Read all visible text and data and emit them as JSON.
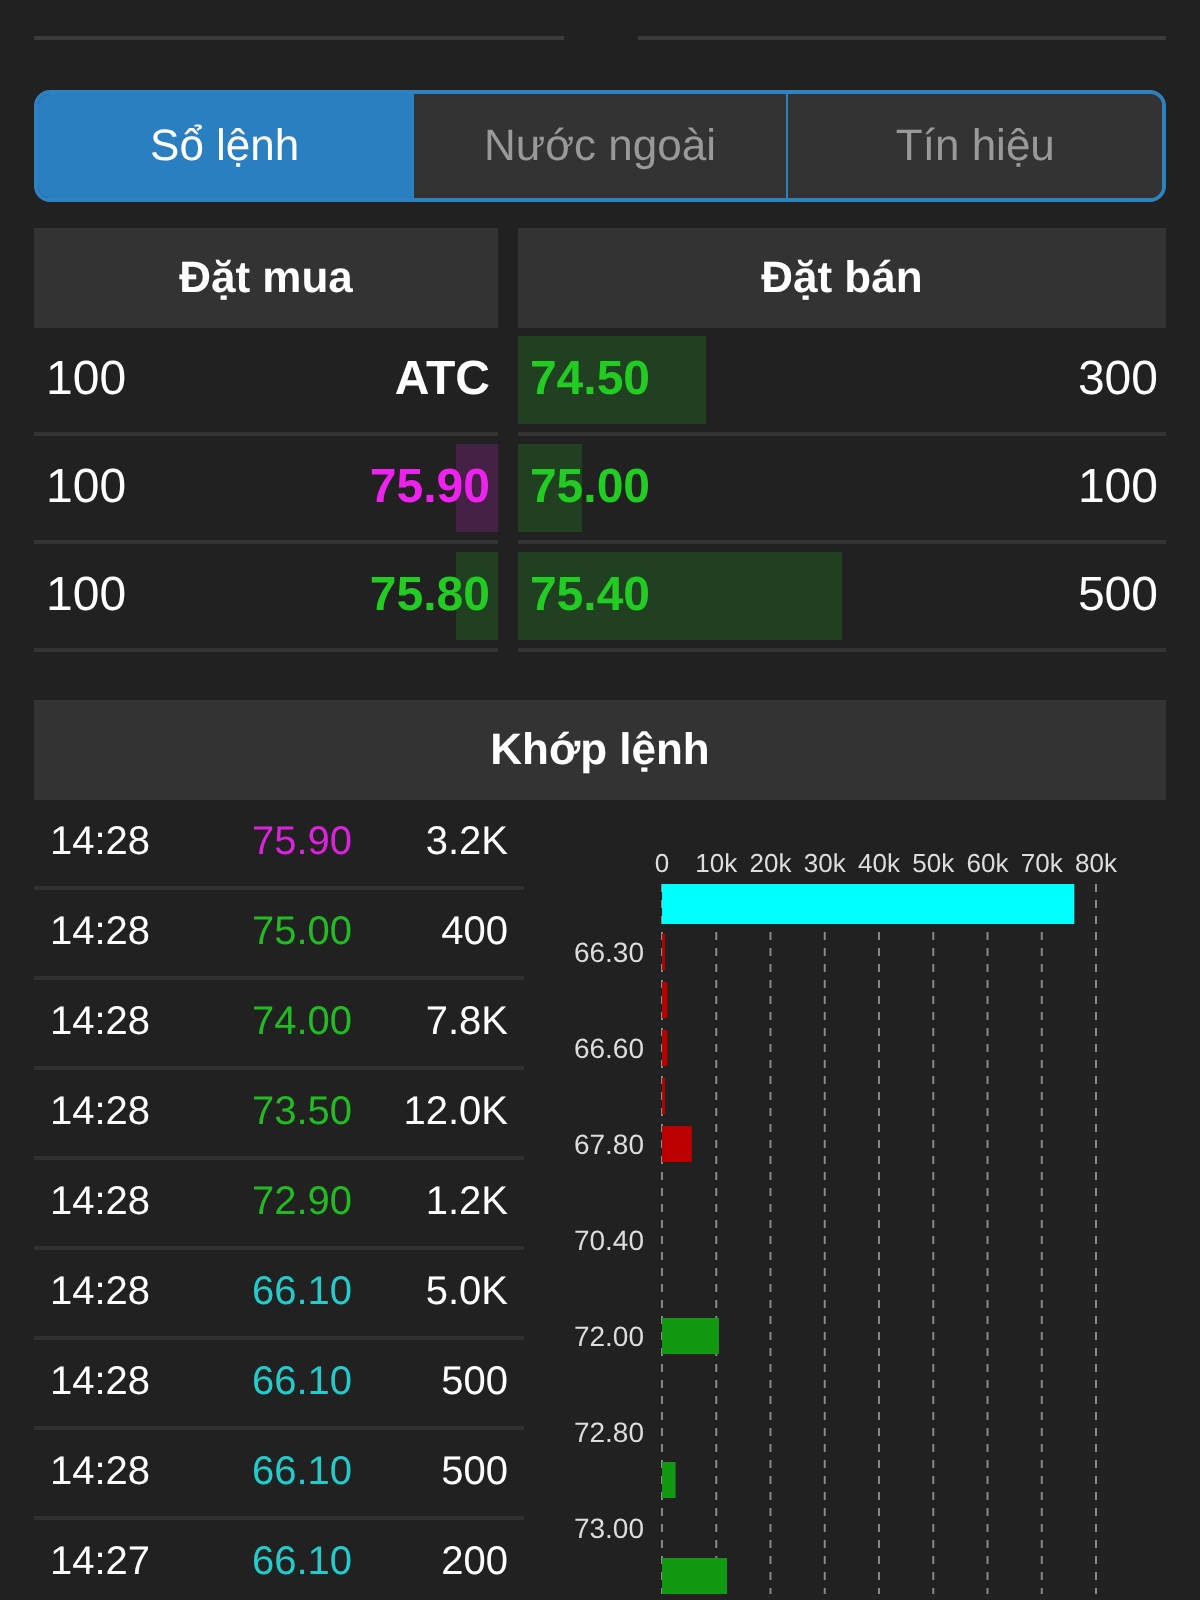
{
  "tabs": [
    {
      "label": "Sổ lệnh",
      "selected": true
    },
    {
      "label": "Nước ngoài",
      "selected": false
    },
    {
      "label": "Tín hiệu",
      "selected": false
    }
  ],
  "order_book": {
    "bid_title": "Đặt mua",
    "ask_title": "Đặt bán",
    "rows": [
      {
        "bid": {
          "volume": "100",
          "price": "ATC",
          "color": "#ffffff"
        },
        "ask": {
          "price": "74.50",
          "color": "#22cc22",
          "level": 0.29,
          "volume": "300"
        }
      },
      {
        "bid": {
          "volume": "100",
          "price": "75.90",
          "color": "#ee22ee",
          "level": 0.09
        },
        "ask": {
          "price": "75.00",
          "color": "#22cc22",
          "level": 0.1,
          "volume": "100"
        }
      },
      {
        "bid": {
          "volume": "100",
          "price": "75.80",
          "color": "#22cc22",
          "level": 0.09
        },
        "ask": {
          "price": "75.40",
          "color": "#22cc22",
          "level": 0.5,
          "volume": "500"
        }
      }
    ]
  },
  "matched": {
    "title": "Khớp lệnh",
    "trades": [
      {
        "time": "14:28",
        "price": "75.90",
        "color": "#dd22dd",
        "volume": "3.2K"
      },
      {
        "time": "14:28",
        "price": "75.00",
        "color": "#22bb22",
        "volume": "400"
      },
      {
        "time": "14:28",
        "price": "74.00",
        "color": "#22bb22",
        "volume": "7.8K"
      },
      {
        "time": "14:28",
        "price": "73.50",
        "color": "#22bb22",
        "volume": "12.0K"
      },
      {
        "time": "14:28",
        "price": "72.90",
        "color": "#22bb22",
        "volume": "1.2K"
      },
      {
        "time": "14:28",
        "price": "66.10",
        "color": "#22cccc",
        "volume": "5.0K"
      },
      {
        "time": "14:28",
        "price": "66.10",
        "color": "#22cccc",
        "volume": "500"
      },
      {
        "time": "14:28",
        "price": "66.10",
        "color": "#22cccc",
        "volume": "500"
      },
      {
        "time": "14:27",
        "price": "66.10",
        "color": "#22cccc",
        "volume": "200"
      }
    ],
    "chart_data": {
      "type": "bar",
      "orientation": "horizontal",
      "categories": [
        null,
        "66.30",
        null,
        "66.60",
        null,
        "67.80",
        null,
        "70.40",
        null,
        "72.00",
        null,
        "72.80",
        null,
        "73.00",
        null
      ],
      "series": [
        {
          "color": "#00ffff",
          "values": [
            76000,
            null,
            null,
            null,
            null,
            null,
            null,
            null,
            null,
            null,
            null,
            null,
            null,
            null,
            null
          ]
        },
        {
          "color": "#bb0000",
          "values": [
            null,
            500,
            1000,
            1000,
            200,
            5500,
            null,
            null,
            null,
            null,
            null,
            null,
            null,
            null,
            null
          ]
        },
        {
          "color": "#119911",
          "values": [
            null,
            null,
            null,
            null,
            null,
            null,
            null,
            null,
            null,
            10500,
            null,
            null,
            2500,
            null,
            12000
          ]
        }
      ],
      "xlim": [
        0,
        80000
      ],
      "grid": true,
      "xticks": [
        {
          "value": 0,
          "label": "0"
        },
        {
          "value": 10000,
          "label": "10k"
        },
        {
          "value": 20000,
          "label": "20k"
        },
        {
          "value": 30000,
          "label": "30k"
        },
        {
          "value": 40000,
          "label": "40k"
        },
        {
          "value": 50000,
          "label": "50k"
        },
        {
          "value": 60000,
          "label": "60k"
        },
        {
          "value": 70000,
          "label": "70k"
        },
        {
          "value": 80000,
          "label": "80k"
        }
      ]
    }
  }
}
